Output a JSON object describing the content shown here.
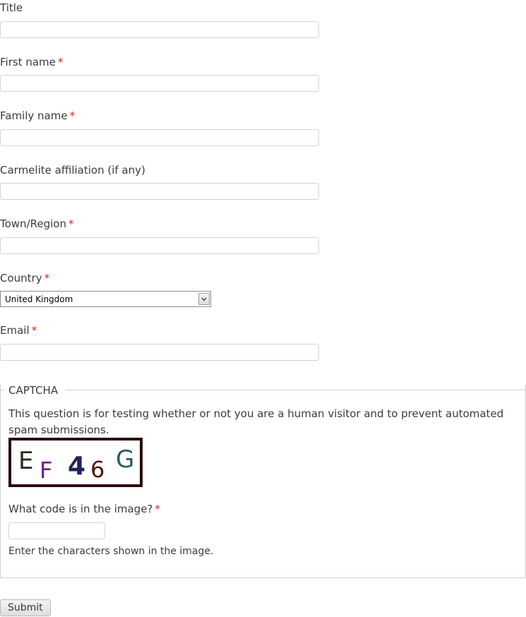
{
  "form": {
    "title_label": "Title",
    "first_name_label": "First name",
    "family_name_label": "Family name",
    "affiliation_label": "Carmelite affiliation (if any)",
    "town_label": "Town/Region",
    "country_label": "Country",
    "country_value": "United Kingdom",
    "email_label": "Email",
    "required_marker": "*",
    "submit_label": "Submit"
  },
  "captcha": {
    "legend": "CAPTCHA",
    "description": "This question is for testing whether or not you are a human visitor and to prevent automated spam submissions.",
    "image_chars": [
      "E",
      "F",
      "4",
      "6",
      "G"
    ],
    "image_colors": [
      "#2e2a1c",
      "#6a1f7a",
      "#22225a",
      "#4a1810",
      "#2c5c5c"
    ],
    "question_label": "What code is in the image?",
    "help_text": "Enter the characters shown in the image."
  }
}
